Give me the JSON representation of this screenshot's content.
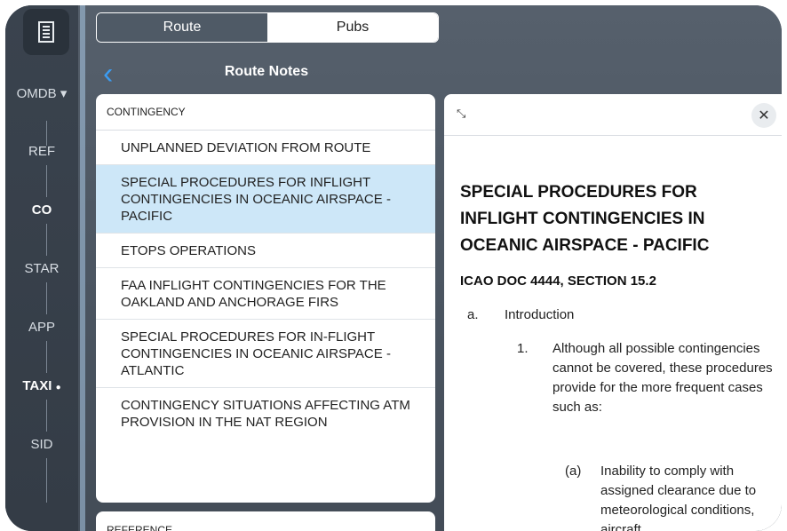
{
  "rail": {
    "airport": "OMDB",
    "items": [
      "REF",
      "CO",
      "STAR",
      "APP",
      "TAXI",
      "SID"
    ]
  },
  "tabs": {
    "route": "Route",
    "pubs": "Pubs"
  },
  "nav": {
    "title": "Route Notes"
  },
  "list": {
    "header": "CONTINGENCY",
    "items": [
      "UNPLANNED DEVIATION FROM ROUTE",
      "SPECIAL PROCEDURES FOR INFLIGHT CONTINGENCIES IN OCEANIC AIRSPACE - PACIFIC",
      "ETOPS OPERATIONS",
      "FAA INFLIGHT CONTINGENCIES FOR THE OAKLAND AND ANCHORAGE FIRS",
      "SPECIAL PROCEDURES FOR IN-FLIGHT CONTINGENCIES IN OCEANIC AIRSPACE - ATLANTIC",
      "CONTINGENCY SITUATIONS AFFECTING ATM PROVISION IN THE NAT REGION"
    ],
    "selected_index": 1,
    "next_header": "REFERENCE"
  },
  "detail": {
    "title": "SPECIAL PROCEDURES FOR INFLIGHT CONTINGENCIES IN OCEANIC AIRSPACE - PACIFIC",
    "subtitle": "ICAO DOC 4444, SECTION 15.2",
    "a_marker": "a.",
    "a_text": "Introduction",
    "n1_marker": "1.",
    "n1_text": "Although all possible contingencies cannot be covered, these procedures provide for the more frequent cases such as:",
    "sa_marker": "(a)",
    "sa_text": "Inability to comply with assigned clearance due to meteorological conditions, aircraft"
  },
  "colors": {
    "accent": "#3b9cf2",
    "selected_row": "#cde7f8"
  }
}
